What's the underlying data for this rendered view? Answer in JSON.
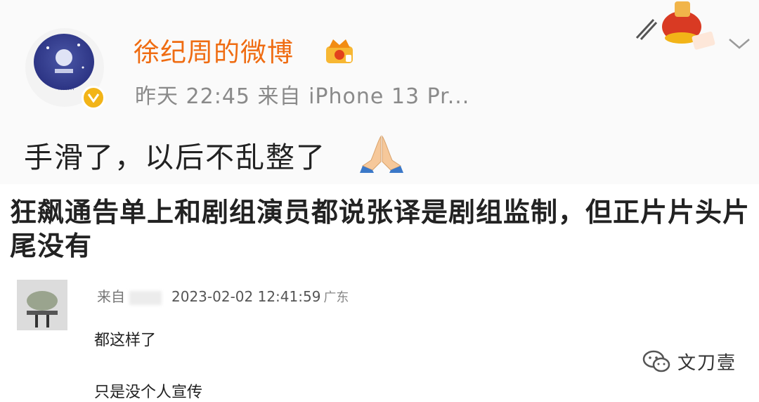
{
  "post": {
    "username": "徐纪周的微博",
    "meta": "昨天 22:45  来自 iPhone 13 Pr...",
    "text": "手滑了，以后不乱整了"
  },
  "headline": "狂飙通告单上和剧组演员都说张译是剧组监制，但正片片头片尾没有",
  "comment": {
    "from_label": "来自",
    "datetime": "2023-02-02 12:41:59",
    "location": "广东",
    "line1": "都这样了",
    "line2": "只是没个人宣传"
  },
  "watermark": {
    "text": "文刀壹"
  },
  "colors": {
    "username": "#ef6c12",
    "verify": "#f2b418",
    "meta": "#8a8a8a"
  },
  "icons": [
    "verified-badge-icon",
    "crown-icon",
    "chevron-down-icon",
    "pray-hands-emoji",
    "wechat-icon"
  ]
}
